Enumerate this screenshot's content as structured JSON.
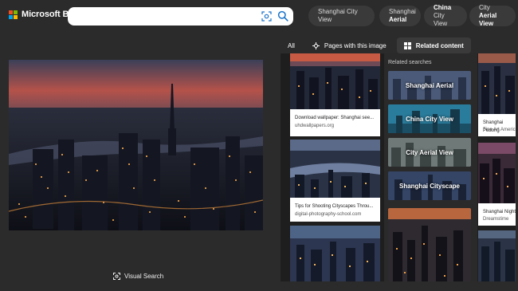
{
  "brand": {
    "name": "Microsoft Bing",
    "colors": [
      "#f25022",
      "#7fba00",
      "#00a4ef",
      "#ffb900"
    ]
  },
  "search": {
    "value": "",
    "camera_icon": "visual-search-icon",
    "search_icon": "magnifier-icon"
  },
  "chips": [
    {
      "line1": "Shanghai City View",
      "line2": ""
    },
    {
      "line1": "Shanghai",
      "line2": "Aerial"
    },
    {
      "line1": "China",
      "line2": "City View"
    },
    {
      "line1": "City",
      "line2": "Aerial View"
    }
  ],
  "tabs": {
    "all": "All",
    "pages": "Pages with this image",
    "related": "Related content"
  },
  "visual_search_label": "Visual Search",
  "results": [
    {
      "title": "Download wallpaper: Shanghai see...",
      "source": "uhdwallpapers.org"
    },
    {
      "title": "Tips for Shooting Cityscapes Throu...",
      "source": "digital-photography-school.com"
    },
    {
      "title": "Shanghai Pudong",
      "source": "Fine Art America"
    },
    {
      "title": "Shanghai Night",
      "source": "Dreamstime"
    }
  ],
  "related": {
    "title": "Related searches",
    "items": [
      "Shanghai Aerial",
      "China City View",
      "City Aerial View",
      "Shanghai Cityscape"
    ]
  }
}
